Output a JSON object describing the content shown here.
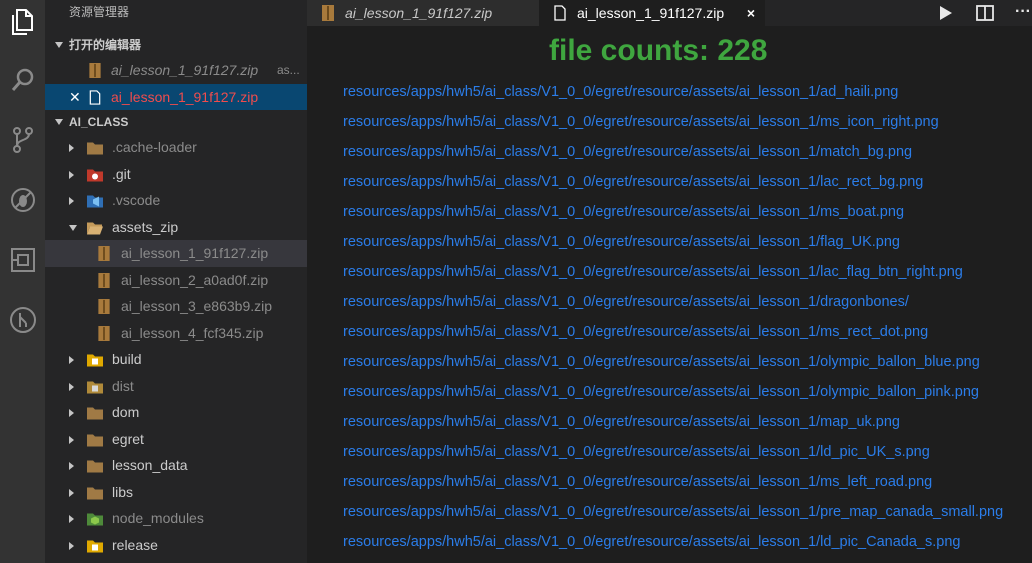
{
  "sidebar": {
    "title": "资源管理器",
    "open_editors": {
      "header": "打开的编辑器",
      "items": [
        {
          "name": "ai_lesson_1_91f127.zip",
          "desc": "as..."
        },
        {
          "name": "ai_lesson_1_91f127.zip"
        }
      ]
    },
    "workspace": {
      "header": "AI_CLASS",
      "items": [
        {
          "name": ".cache-loader"
        },
        {
          "name": ".git"
        },
        {
          "name": ".vscode"
        },
        {
          "name": "assets_zip"
        },
        {
          "name": "ai_lesson_1_91f127.zip"
        },
        {
          "name": "ai_lesson_2_a0ad0f.zip"
        },
        {
          "name": "ai_lesson_3_e863b9.zip"
        },
        {
          "name": "ai_lesson_4_fcf345.zip"
        },
        {
          "name": "build"
        },
        {
          "name": "dist"
        },
        {
          "name": "dom"
        },
        {
          "name": "egret"
        },
        {
          "name": "lesson_data"
        },
        {
          "name": "libs"
        },
        {
          "name": "node_modules"
        },
        {
          "name": "release"
        }
      ]
    }
  },
  "tabs": [
    {
      "label": "ai_lesson_1_91f127.zip"
    },
    {
      "label": "ai_lesson_1_91f127.zip",
      "close": "×"
    }
  ],
  "editor": {
    "count_text": "file counts: 228",
    "files": [
      "resources/apps/hwh5/ai_class/V1_0_0/egret/resource/assets/ai_lesson_1/ad_haili.png",
      "resources/apps/hwh5/ai_class/V1_0_0/egret/resource/assets/ai_lesson_1/ms_icon_right.png",
      "resources/apps/hwh5/ai_class/V1_0_0/egret/resource/assets/ai_lesson_1/match_bg.png",
      "resources/apps/hwh5/ai_class/V1_0_0/egret/resource/assets/ai_lesson_1/lac_rect_bg.png",
      "resources/apps/hwh5/ai_class/V1_0_0/egret/resource/assets/ai_lesson_1/ms_boat.png",
      "resources/apps/hwh5/ai_class/V1_0_0/egret/resource/assets/ai_lesson_1/flag_UK.png",
      "resources/apps/hwh5/ai_class/V1_0_0/egret/resource/assets/ai_lesson_1/lac_flag_btn_right.png",
      "resources/apps/hwh5/ai_class/V1_0_0/egret/resource/assets/ai_lesson_1/dragonbones/",
      "resources/apps/hwh5/ai_class/V1_0_0/egret/resource/assets/ai_lesson_1/ms_rect_dot.png",
      "resources/apps/hwh5/ai_class/V1_0_0/egret/resource/assets/ai_lesson_1/olympic_ballon_blue.png",
      "resources/apps/hwh5/ai_class/V1_0_0/egret/resource/assets/ai_lesson_1/olympic_ballon_pink.png",
      "resources/apps/hwh5/ai_class/V1_0_0/egret/resource/assets/ai_lesson_1/map_uk.png",
      "resources/apps/hwh5/ai_class/V1_0_0/egret/resource/assets/ai_lesson_1/ld_pic_UK_s.png",
      "resources/apps/hwh5/ai_class/V1_0_0/egret/resource/assets/ai_lesson_1/ms_left_road.png",
      "resources/apps/hwh5/ai_class/V1_0_0/egret/resource/assets/ai_lesson_1/pre_map_canada_small.png",
      "resources/apps/hwh5/ai_class/V1_0_0/egret/resource/assets/ai_lesson_1/ld_pic_Canada_s.png"
    ]
  },
  "colors": {
    "accent_green": "#3fa63f",
    "link_blue": "#2b7de9",
    "active_red": "#f14c4c"
  }
}
